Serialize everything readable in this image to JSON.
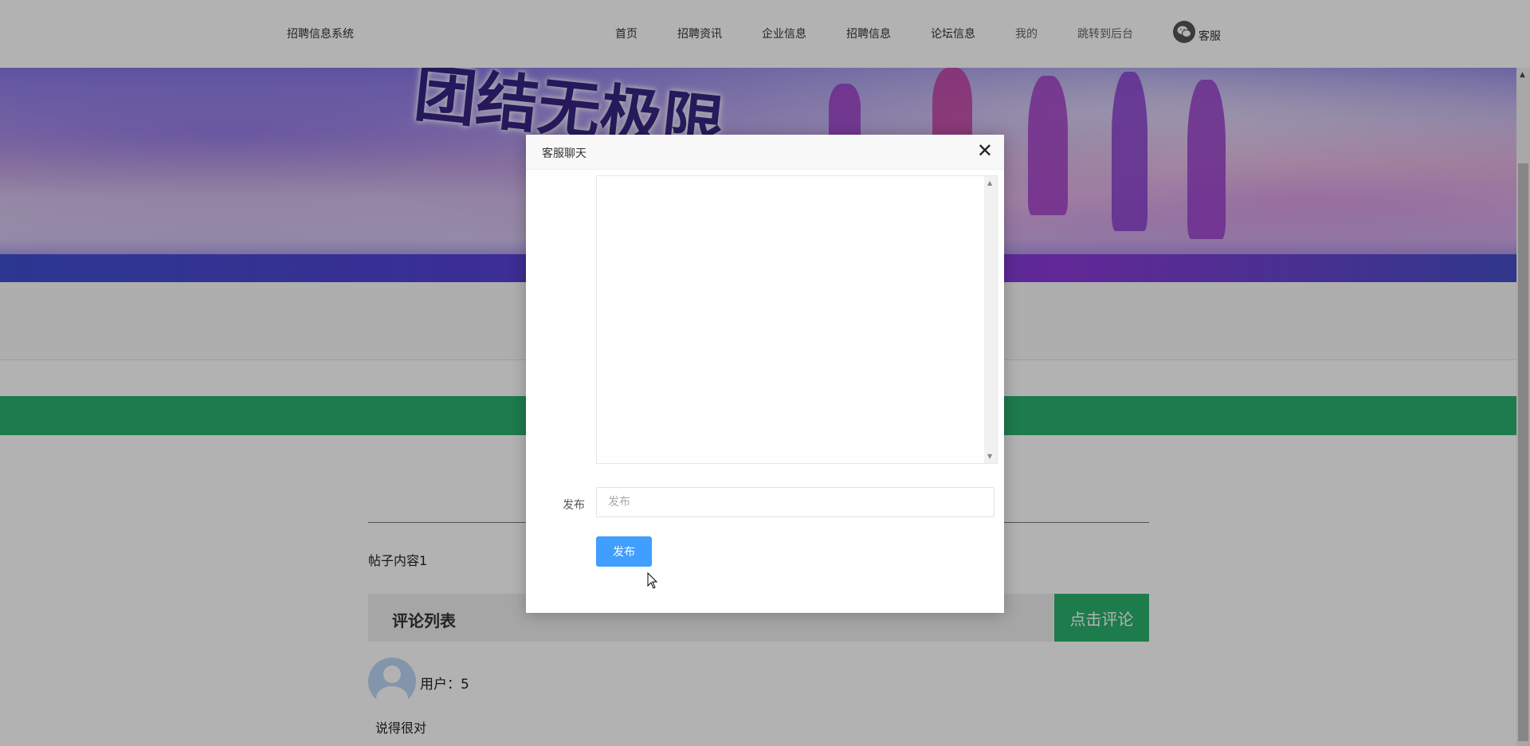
{
  "header": {
    "site_title": "招聘信息系统",
    "nav": [
      {
        "label": "首页"
      },
      {
        "label": "招聘资讯"
      },
      {
        "label": "企业信息"
      },
      {
        "label": "招聘信息"
      },
      {
        "label": "论坛信息"
      },
      {
        "label": "我的"
      },
      {
        "label": "跳转到后台"
      }
    ],
    "service": {
      "label": "客服",
      "icon": "wechat-icon"
    }
  },
  "banner": {
    "slogan": "团结无极限"
  },
  "post": {
    "content": "帖子内容1",
    "comments_title": "评论列表",
    "comment_button": "点击评论",
    "comments": [
      {
        "user_prefix": "用户：",
        "user": "5",
        "text": "说得很对"
      }
    ]
  },
  "modal": {
    "title": "客服聊天",
    "close_icon": "close-icon",
    "form_label": "发布",
    "input_placeholder": "发布",
    "input_value": "",
    "submit_label": "发布"
  }
}
